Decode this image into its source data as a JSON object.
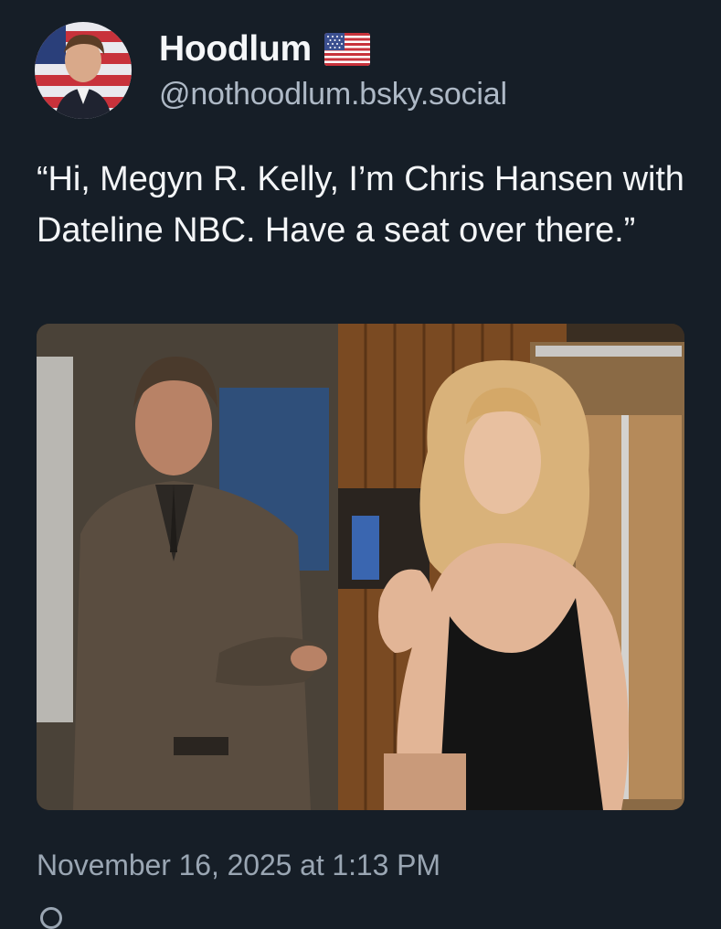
{
  "author": {
    "display_name": "Hoodlum",
    "handle": "@nothoodlum.bsky.social",
    "name_emoji": "flag-us-icon",
    "avatar_icon": "avatar"
  },
  "post": {
    "text": "“Hi, Megyn R. Kelly, I’m Chris Hansen with Dateline NBC. Have a seat over there.”",
    "image_icon": "post-image",
    "timestamp": "November 16, 2025 at 1:13 PM"
  },
  "colors": {
    "background": "#161e27",
    "text_primary": "#f3f5f7",
    "text_secondary": "#aeb9c6",
    "timestamp": "#9aa6b3"
  }
}
